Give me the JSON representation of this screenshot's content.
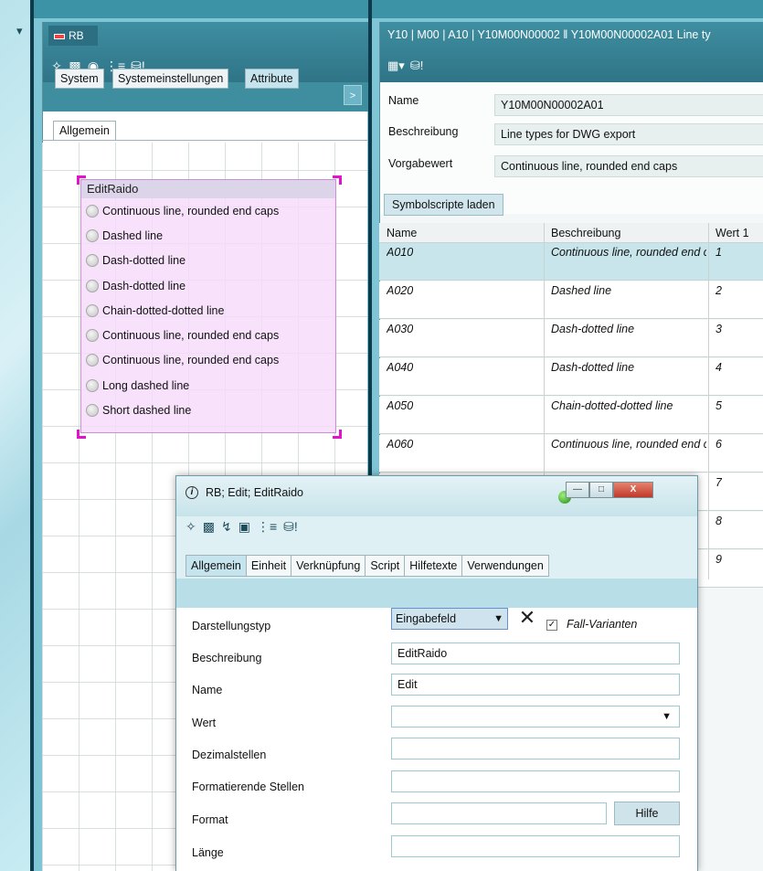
{
  "left_panel": {
    "tab": "RB",
    "toolbar_icons": [
      "crosshair-icon",
      "folder-icon",
      "record-icon",
      "properties-icon",
      "db-alert-icon"
    ],
    "tabs": [
      "System",
      "Systemeinstellungen",
      "Attribute"
    ],
    "subtab": "Allgemein",
    "radio_group": {
      "title": "EditRaido",
      "items": [
        "Continuous line, rounded end caps",
        "Dashed line",
        "Dash-dotted line",
        "Dash-dotted line",
        "Chain-dotted-dotted line",
        "Continuous line, rounded end caps",
        "Continuous line, rounded end caps",
        "Long dashed line",
        "Short dashed line"
      ]
    }
  },
  "right_panel": {
    "title": "Y10 | M00 | A10 | Y10M00N00002 ‖ Y10M00N00002A01 Line ty",
    "form": {
      "name_label": "Name",
      "name_value": "Y10M00N00002A01",
      "beschreibung_label": "Beschreibung",
      "beschreibung_value": "Line types for DWG export",
      "vorgabewert_label": "Vorgabewert",
      "vorgabewert_value": "Continuous line, rounded end caps"
    },
    "load_button": "Symbolscripte laden",
    "table": {
      "headers": [
        "Name",
        "Beschreibung",
        "Wert 1"
      ],
      "rows": [
        {
          "name": "A010",
          "desc": "Continuous line, rounded end caps",
          "wert": "1"
        },
        {
          "name": "A020",
          "desc": "Dashed line",
          "wert": "2"
        },
        {
          "name": "A030",
          "desc": "Dash-dotted line",
          "wert": "3"
        },
        {
          "name": "A040",
          "desc": "Dash-dotted line",
          "wert": "4"
        },
        {
          "name": "A050",
          "desc": "Chain-dotted-dotted line",
          "wert": "5"
        },
        {
          "name": "A060",
          "desc": "Continuous line, rounded end caps",
          "wert": "6"
        },
        {
          "name": "",
          "desc": "",
          "wert": "7"
        },
        {
          "name": "",
          "desc": "",
          "wert": "8"
        },
        {
          "name": "",
          "desc": "",
          "wert": "9"
        }
      ]
    }
  },
  "dialog": {
    "title": "RB; Edit; EditRaido",
    "tabs": [
      "Allgemein",
      "Einheit",
      "Verknüpfung",
      "Script",
      "Hilfetexte",
      "Verwendungen"
    ],
    "fields": {
      "darstellungstyp_label": "Darstellungstyp",
      "darstellungstyp_value": "Eingabefeld",
      "fall_varianten_label": "Fall-Varianten",
      "beschreibung_label": "Beschreibung",
      "beschreibung_value": "EditRaido",
      "name_label": "Name",
      "name_value": "Edit",
      "wert_label": "Wert",
      "wert_value": "",
      "dezimalstellen_label": "Dezimalstellen",
      "formatierende_label": "Formatierende Stellen",
      "format_label": "Format",
      "hilfe_button": "Hilfe",
      "laenge_label": "Länge"
    }
  }
}
